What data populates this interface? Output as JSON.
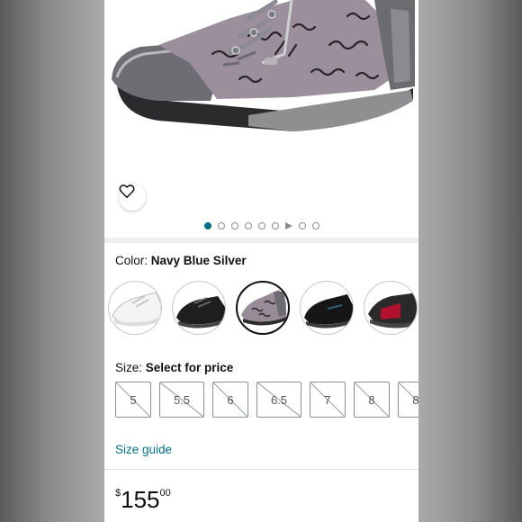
{
  "carousel": {
    "dot_count": 9,
    "active_index": 0,
    "video_index": 6
  },
  "color": {
    "label": "Color:",
    "selected": "Navy Blue Silver",
    "swatches": [
      {
        "name": "white",
        "selected": false
      },
      {
        "name": "black",
        "selected": false
      },
      {
        "name": "navy-blue-silver",
        "selected": true
      },
      {
        "name": "black-gore-tex",
        "selected": false
      },
      {
        "name": "red-black",
        "selected": false
      }
    ]
  },
  "size": {
    "label": "Size:",
    "value": "Select for price",
    "options": [
      "5",
      "5.5",
      "6",
      "6.5",
      "7",
      "8",
      "8"
    ],
    "unavailable": true
  },
  "size_guide": "Size guide",
  "price": {
    "symbol": "$",
    "whole": "155",
    "fraction": "00"
  },
  "colors": {
    "link": "#007185",
    "active_dot": "#007185",
    "text": "#0f1111"
  },
  "icons": {
    "wishlist": "heart-icon",
    "video": "play-icon"
  }
}
